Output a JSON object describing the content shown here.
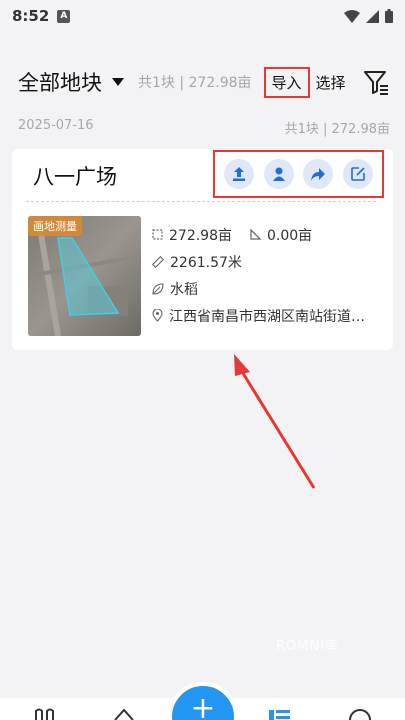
{
  "status_bar": {
    "time": "8:52",
    "app_badge": "A",
    "icons": [
      "wifi-icon",
      "signal-icon",
      "battery-icon"
    ]
  },
  "header": {
    "title": "全部地块",
    "summary": "共1块 | 272.98亩",
    "import_label": "导入",
    "select_label": "选择",
    "icons": [
      "dropdown-triangle-icon",
      "filter-list-icon"
    ]
  },
  "group": {
    "date": "2025-07-16",
    "summary": "共1块 | 272.98亩"
  },
  "card": {
    "name": "八一广场",
    "actions": [
      "upload-icon",
      "person-icon",
      "share-icon",
      "edit-icon"
    ],
    "badge": "画地测量",
    "area": "272.98亩",
    "secondary_area": "0.00亩",
    "perimeter": "2261.57米",
    "crop": "水稻",
    "address": "江西省南昌市西湖区南站街道南..."
  },
  "watermark": "ROMNI库",
  "colors": {
    "accent": "#2196f3",
    "highlight": "#e53935",
    "action_bg": "#dfe7f8",
    "badge": "#d98934"
  }
}
